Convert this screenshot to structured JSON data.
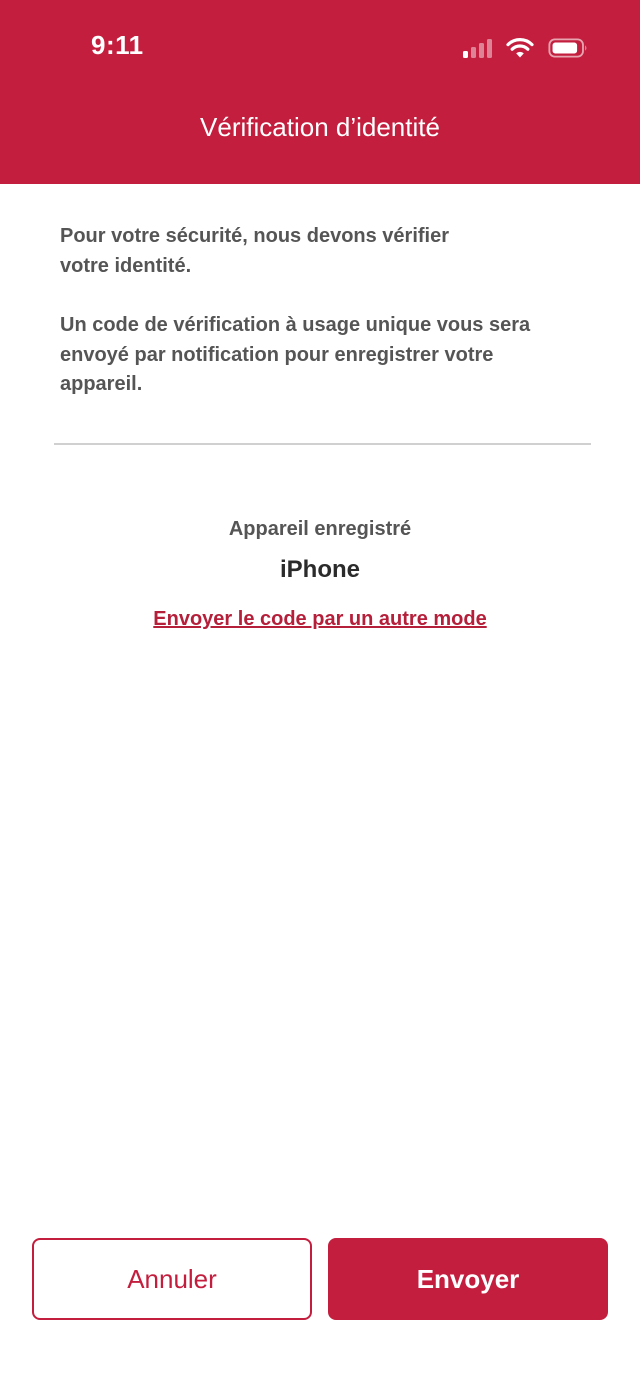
{
  "status_bar": {
    "time": "9:11",
    "icons": [
      "cellular-signal-icon",
      "wifi-icon",
      "battery-icon"
    ]
  },
  "header": {
    "title": "Vérification d’identité",
    "background_color": "#c41e3e"
  },
  "intro": {
    "paragraph_1": "Pour votre sécurité, nous devons vérifier votre identité.",
    "paragraph_2": "Un code de vérification à usage unique vous sera envoyé par notification pour enregistrer votre appareil."
  },
  "device": {
    "label": "Appareil enregistré",
    "name": "iPhone"
  },
  "alternate_link": "Envoyer le code par un autre mode",
  "buttons": {
    "cancel_label": "Annuler",
    "send_label": "Envoyer"
  },
  "colors": {
    "accent": "#c41e3e",
    "text_body": "#555555",
    "text_strong": "#2b2b2b"
  }
}
